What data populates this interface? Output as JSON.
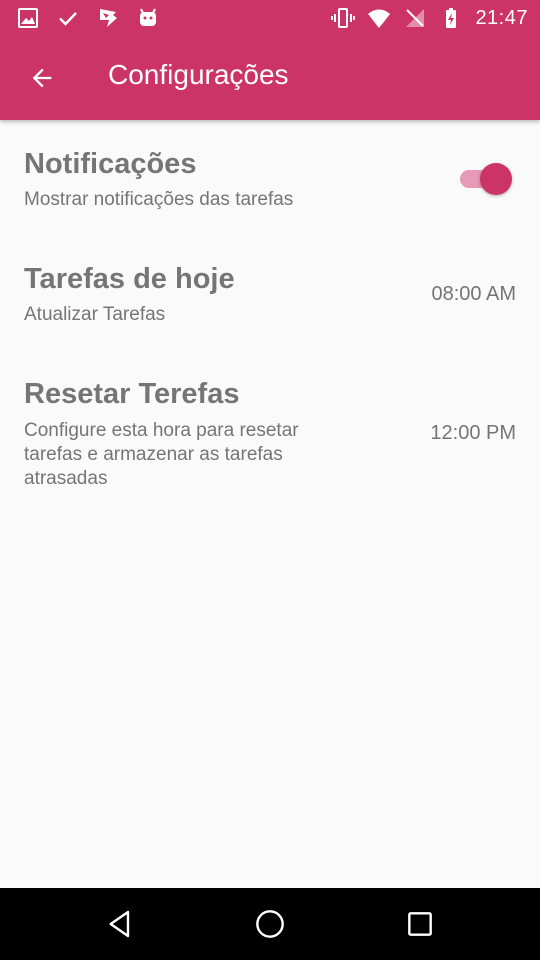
{
  "status_bar": {
    "time": "21:47",
    "left_icons": [
      "image-icon",
      "check-icon",
      "store-icon",
      "android-icon"
    ],
    "right_icons": [
      "vibrate-icon",
      "wifi-icon",
      "no-signal-icon",
      "battery-charging-icon"
    ]
  },
  "toolbar": {
    "title": "Configurações",
    "back_icon": "arrow-back-icon",
    "background_color": "#cc3366"
  },
  "preferences": {
    "notifications": {
      "title": "Notificações",
      "summary": "Mostrar notificações das tarefas",
      "switch_on": true
    },
    "today_tasks": {
      "title": "Tarefas de hoje",
      "summary": "Atualizar Tarefas",
      "value": "08:00 AM"
    },
    "reset_tasks": {
      "title": "Resetar Terefas",
      "summary": "Configure esta hora para resetar tarefas e armazenar as tarefas atrasadas",
      "value": "12:00 PM"
    }
  },
  "nav_bar": {
    "buttons": [
      "back-triangle-icon",
      "home-circle-icon",
      "recents-square-icon"
    ]
  },
  "colors": {
    "accent": "#cc3366",
    "text_secondary": "#757575",
    "background": "#fafafa"
  }
}
